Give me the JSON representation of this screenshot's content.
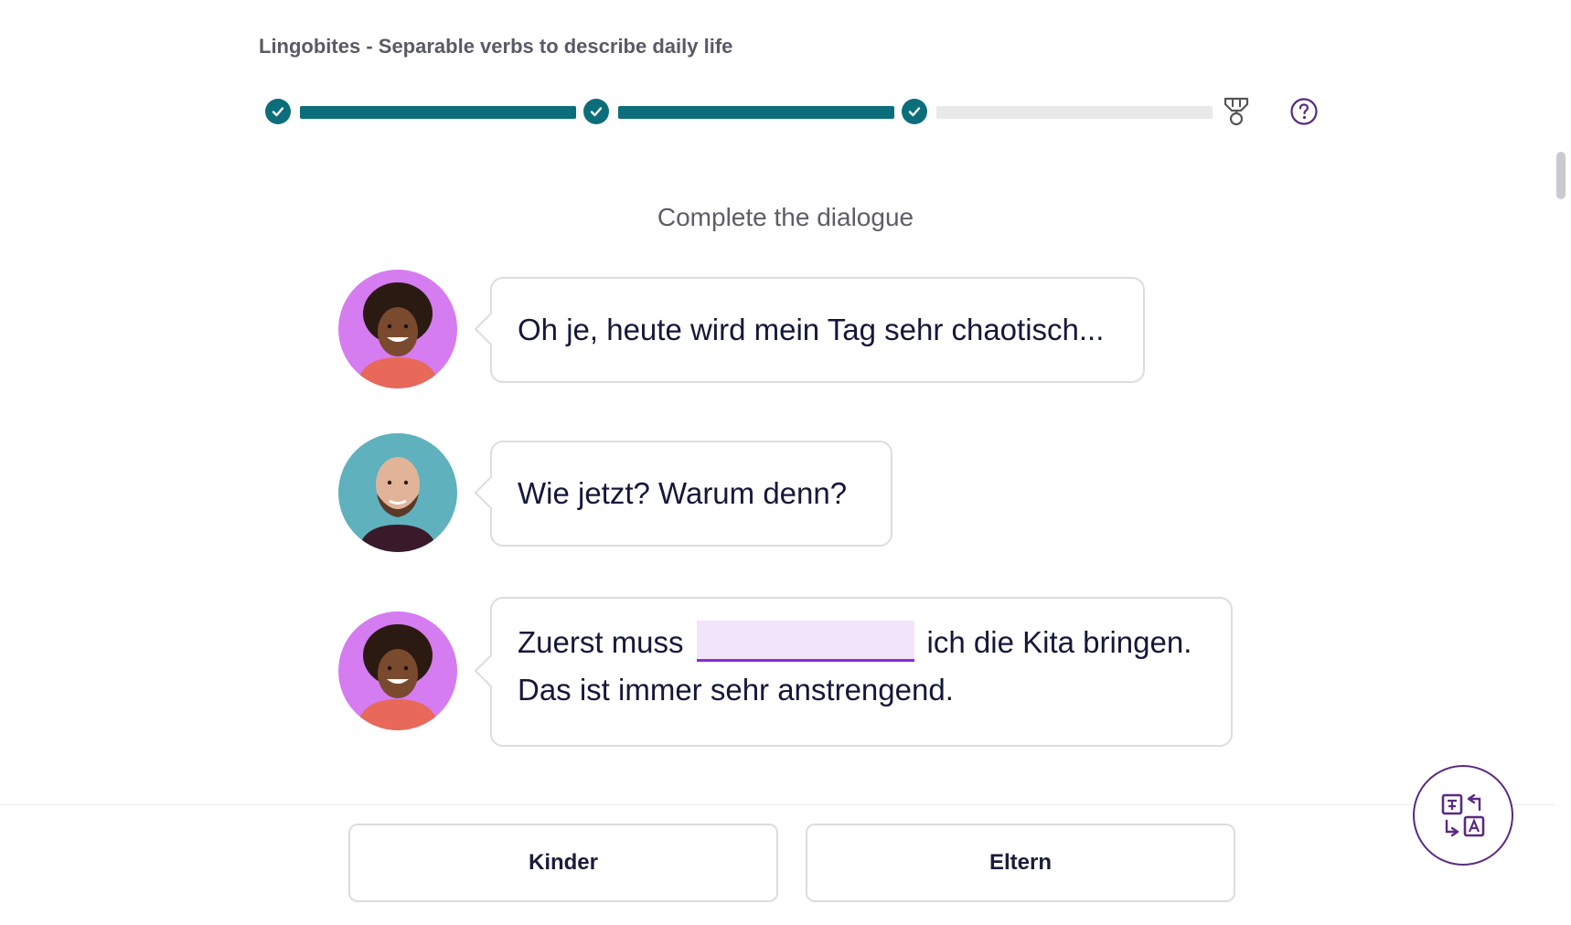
{
  "header": {
    "lesson_title": "Lingobites - Separable verbs to describe daily life"
  },
  "progress": {
    "completed_steps": 3,
    "total_segments": 3,
    "trophy_icon": "trophy-icon",
    "help_icon": "help-icon"
  },
  "exercise": {
    "instruction": "Complete the dialogue",
    "messages": [
      {
        "speaker": "woman",
        "line1": "Oh je, heute wird mein Tag sehr chaotisch..."
      },
      {
        "speaker": "man",
        "line1": "Wie jetzt? Warum denn?"
      },
      {
        "speaker": "woman",
        "before_blank": "Zuerst muss",
        "after_blank": "ich die Kita bringen.",
        "line2": "Das ist immer sehr anstrengend."
      }
    ]
  },
  "answers": {
    "option1": "Kinder",
    "option2": "Eltern"
  },
  "colors": {
    "accent_teal": "#0b6e7a",
    "blank_fill": "#f2e4fb",
    "blank_underline": "#8a2bd6",
    "avatar_woman_bg": "#d57cf0",
    "avatar_man_bg": "#5fb1bd",
    "translate_border": "#5a2a82"
  }
}
